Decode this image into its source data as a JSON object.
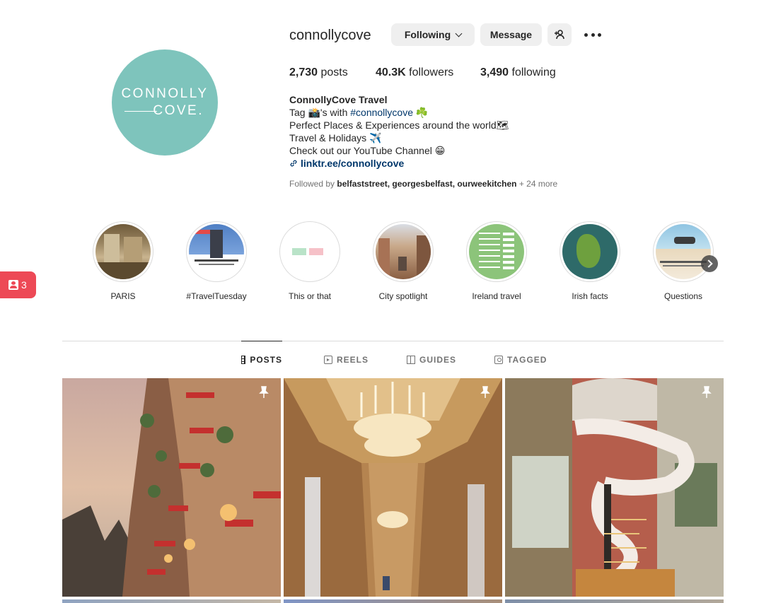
{
  "profile": {
    "username": "connollycove",
    "avatar_text_line1": "CONNOLLY",
    "avatar_text_line2": "COVE.",
    "avatar_color": "#7ec4bc",
    "following_label": "Following",
    "message_label": "Message",
    "stats": {
      "posts_count": "2,730",
      "posts_label": "posts",
      "followers_count": "40.3K",
      "followers_label": "followers",
      "following_count": "3,490",
      "following_label": "following"
    },
    "full_name": "ConnollyCove Travel",
    "bio": {
      "line1_pre": "Tag 📸's with ",
      "line1_tag": "#connollycove",
      "line1_post": " ☘️",
      "line2": "Perfect Places & Experiences around the world🗺",
      "line3": "Travel & Holidays ✈️",
      "line4": "Check out our YouTube Channel 😁",
      "link": "linktr.ee/connollycove"
    },
    "followed_by_prefix": "Followed by",
    "followed_by_names": "belfaststreet, georgesbelfast, ourweekitchen",
    "followed_by_more": "+ 24 more"
  },
  "highlights": [
    {
      "label": "PARIS"
    },
    {
      "label": "#TravelTuesday"
    },
    {
      "label": "This or that"
    },
    {
      "label": "City spotlight"
    },
    {
      "label": "Ireland travel"
    },
    {
      "label": "Irish facts"
    },
    {
      "label": "Questions"
    }
  ],
  "side_badge": {
    "count": "3"
  },
  "tabs": [
    {
      "label": "POSTS",
      "active": true
    },
    {
      "label": "REELS",
      "active": false
    },
    {
      "label": "GUIDES",
      "active": false
    },
    {
      "label": "TAGGED",
      "active": false
    }
  ],
  "posts": [
    {
      "pinned": true
    },
    {
      "pinned": true
    },
    {
      "pinned": true
    }
  ],
  "colors": {
    "accent_link": "#00376b",
    "badge_red": "#ed4956",
    "button_bg": "#efefef"
  }
}
